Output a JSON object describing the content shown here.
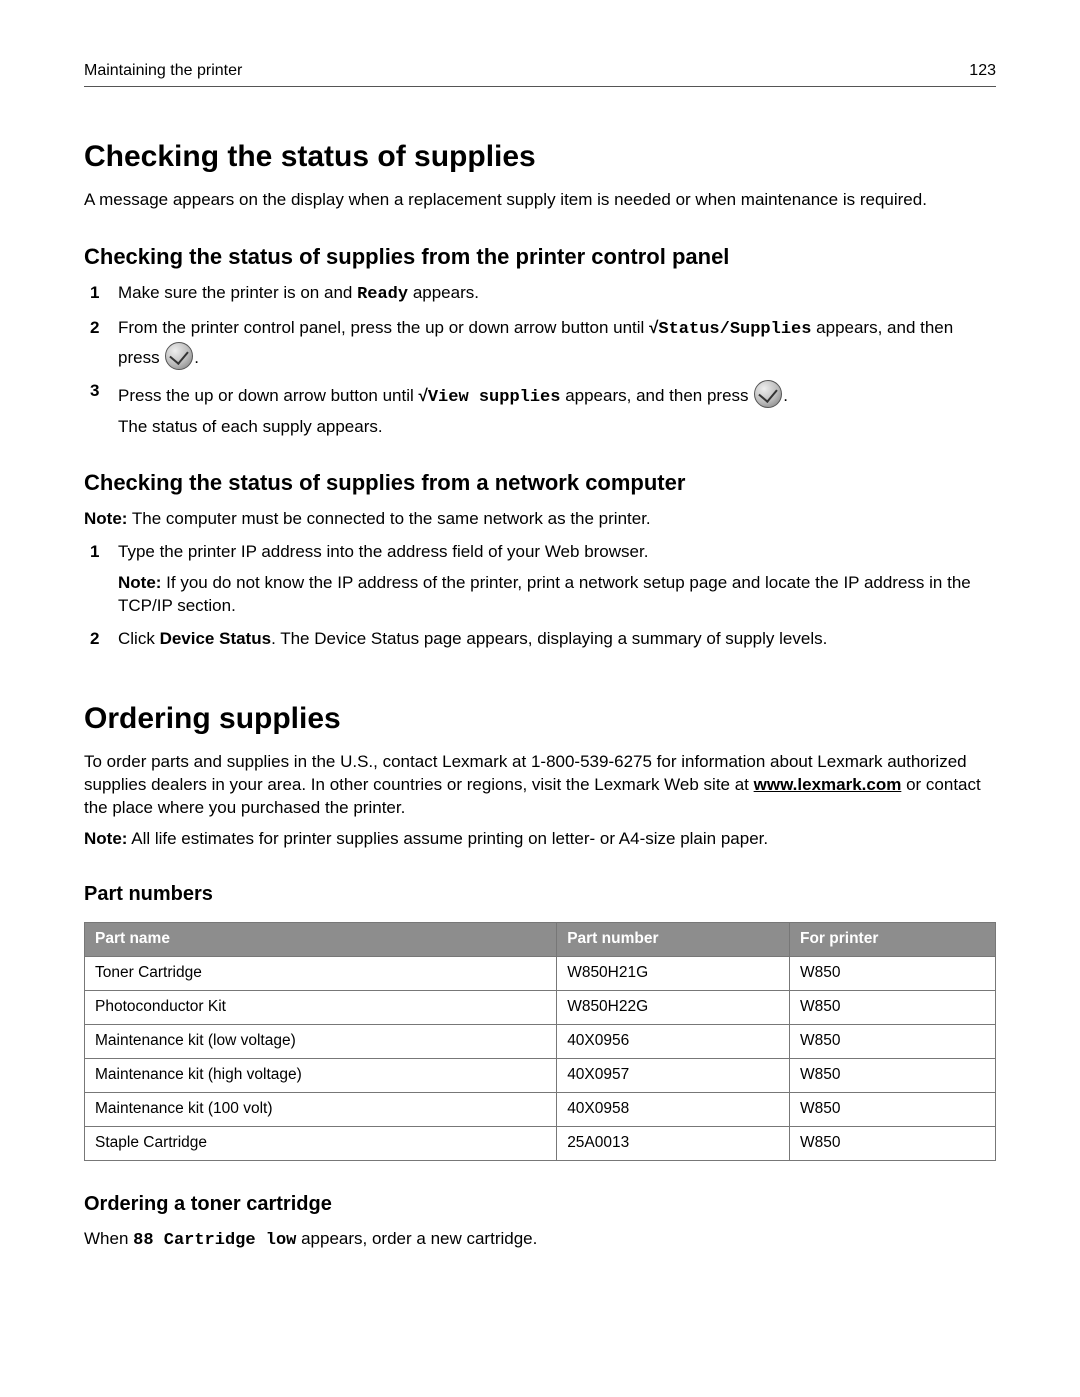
{
  "header": {
    "left": "Maintaining the printer",
    "page": "123"
  },
  "s1": {
    "title": "Checking the status of supplies",
    "intro": "A message appears on the display when a replacement supply item is needed or when maintenance is required."
  },
  "s1a": {
    "title": "Checking the status of supplies from the printer control panel",
    "step1_a": "Make sure the printer is on and ",
    "step1_ready": "Ready",
    "step1_b": " appears.",
    "step2_a": "From the printer control panel, press the up or down arrow button until ",
    "step2_check": "√",
    "step2_menu": "Status/Supplies",
    "step2_b": " appears, and then press ",
    "step2_c": ".",
    "step3_a": "Press the up or down arrow button until ",
    "step3_check": "√",
    "step3_menu": "View supplies",
    "step3_b": " appears, and then press ",
    "step3_c": ".",
    "step3_d": "The status of each supply appears."
  },
  "s1b": {
    "title": "Checking the status of supplies from a network computer",
    "noteLabel": "Note:",
    "noteText": " The computer must be connected to the same network as the printer.",
    "step1": "Type the printer IP address into the address field of your Web browser.",
    "step1_noteLabel": "Note:",
    "step1_noteText": " If you do not know the IP address of the printer, print a network setup page and locate the IP address in the TCP/IP section.",
    "step2_a": "Click ",
    "step2_bold": "Device Status",
    "step2_b": ". The Device Status page appears, displaying a summary of supply levels."
  },
  "s2": {
    "title": "Ordering supplies",
    "para_a": "To order parts and supplies in the U.S., contact Lexmark at 1-800-539-6275 for information about Lexmark authorized supplies dealers in your area. In other countries or regions, visit the Lexmark Web site at ",
    "link": "www.lexmark.com",
    "para_b": " or contact the place where you purchased the printer.",
    "noteLabel": "Note:",
    "noteText": " All life estimates for printer supplies assume printing on letter‑ or A4‑size plain paper."
  },
  "s2a": {
    "title": "Part numbers",
    "table": {
      "headers": [
        "Part name",
        "Part number",
        "For printer"
      ],
      "rows": [
        [
          "Toner Cartridge",
          "W850H21G",
          "W850"
        ],
        [
          "Photoconductor Kit",
          "W850H22G",
          "W850"
        ],
        [
          "Maintenance kit (low voltage)",
          "40X0956",
          "W850"
        ],
        [
          "Maintenance kit (high voltage)",
          "40X0957",
          "W850"
        ],
        [
          "Maintenance kit (100 volt)",
          "40X0958",
          "W850"
        ],
        [
          "Staple Cartridge",
          "25A0013",
          "W850"
        ]
      ]
    }
  },
  "s2b": {
    "title": "Ordering a toner cartridge",
    "a": "When ",
    "msg": "88 Cartridge low",
    "b": " appears, order a new cartridge."
  }
}
